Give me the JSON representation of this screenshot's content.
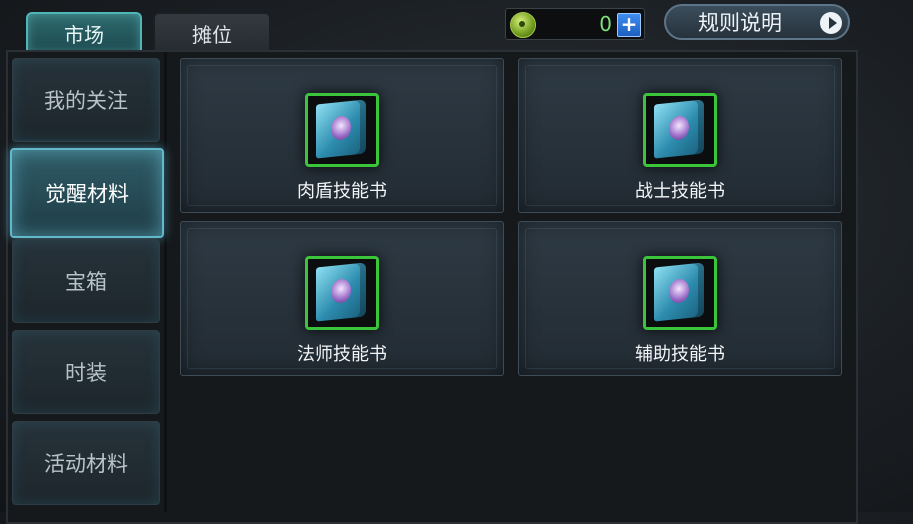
{
  "tabs": {
    "market": "市场",
    "stall": "摊位"
  },
  "currency": {
    "value": "0",
    "plus": "+"
  },
  "rules": {
    "label": "规则说明"
  },
  "sidebar": {
    "items": [
      {
        "label": "我的关注"
      },
      {
        "label": "觉醒材料",
        "active": true
      },
      {
        "label": "宝箱"
      },
      {
        "label": "时装"
      },
      {
        "label": "活动材料"
      }
    ]
  },
  "items": [
    {
      "label": "肉盾技能书"
    },
    {
      "label": "战士技能书"
    },
    {
      "label": "法师技能书"
    },
    {
      "label": "辅助技能书"
    }
  ],
  "colors": {
    "accent": "#63b8cc",
    "frame_green": "#3bc53b",
    "currency_green": "#7fe07a"
  }
}
